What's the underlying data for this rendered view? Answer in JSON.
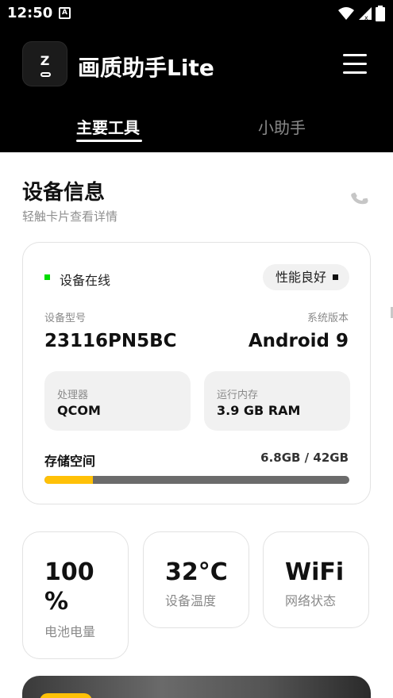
{
  "status_bar": {
    "time": "12:50",
    "notification_icon_label": "A"
  },
  "app": {
    "title": "画质助手Lite",
    "logo_letter": "Z"
  },
  "tabs": [
    {
      "label": "主要工具",
      "active": true
    },
    {
      "label": "小助手",
      "active": false
    }
  ],
  "section": {
    "title": "设备信息",
    "subtitle": "轻触卡片查看详情"
  },
  "device_card": {
    "online_label": "设备在线",
    "performance_badge": "性能良好",
    "model_label": "设备型号",
    "model_value": "23116PN5BC",
    "system_label": "系统版本",
    "system_value": "Android 9",
    "cpu_label": "处理器",
    "cpu_value": "QCOM",
    "ram_label": "运行内存",
    "ram_value": "3.9 GB RAM",
    "storage_label": "存储空间",
    "storage_value": "6.8GB / 42GB",
    "storage_fraction": 0.16
  },
  "stats": {
    "battery_value": "100 %",
    "battery_label": "电池电量",
    "temp_value": "32°C",
    "temp_label": "设备温度",
    "network_value": "WiFi",
    "network_label": "网络状态"
  },
  "colors": {
    "accent": "#ffc107",
    "online": "#00dd00",
    "dark": "#000000"
  },
  "icons": [
    "wifi-icon",
    "signal-icon",
    "battery-icon",
    "menu-icon",
    "phone-icon"
  ]
}
